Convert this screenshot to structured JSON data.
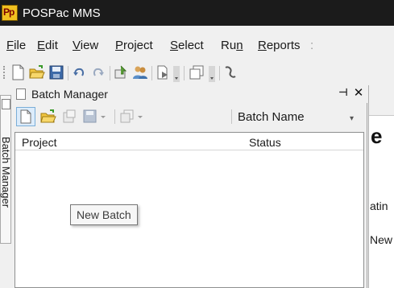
{
  "window": {
    "title": "POSPac MMS",
    "app_icon_text": "Pp"
  },
  "menu": [
    {
      "before": "",
      "mnemonic": "F",
      "after": "ile"
    },
    {
      "before": "",
      "mnemonic": "E",
      "after": "dit"
    },
    {
      "before": "",
      "mnemonic": "V",
      "after": "iew"
    },
    {
      "before": "",
      "mnemonic": "P",
      "after": "roject"
    },
    {
      "before": "",
      "mnemonic": "S",
      "after": "elect"
    },
    {
      "before": "Ru",
      "mnemonic": "n",
      "after": ""
    },
    {
      "before": "",
      "mnemonic": "R",
      "after": "eports"
    }
  ],
  "side_tab": {
    "label": "Batch Manager"
  },
  "panel": {
    "title": "Batch Manager",
    "batch_name_label": "Batch Name",
    "columns": [
      "Project",
      "Status"
    ]
  },
  "tooltip": {
    "text": "New Batch"
  },
  "document": {
    "heading": "e",
    "lines": [
      "atin",
      "New"
    ]
  },
  "colors": {
    "titlebar": "#1b1b1b",
    "accent": "#dcecfb",
    "folder": "#f2c640"
  }
}
